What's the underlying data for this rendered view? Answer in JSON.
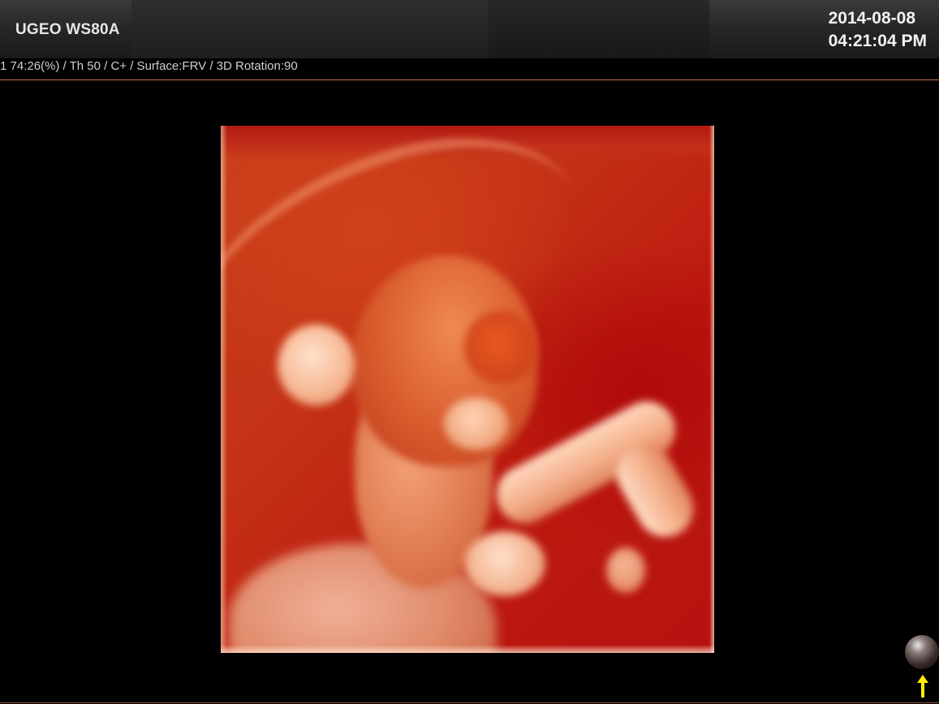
{
  "header": {
    "model": "UGEO WS80A",
    "date": "2014-08-08",
    "time": "04:21:04 PM"
  },
  "status_line": "1 74:26(%) / Th 50 / C+ / Surface:FRV / 3D Rotation:90",
  "viewport": {
    "content": "3D fetal surface rendering",
    "icons": [
      "orientation-sphere-icon",
      "up-arrow-icon"
    ]
  },
  "colors": {
    "accent_line": "#c8764a",
    "arrow": "#ffee00"
  }
}
